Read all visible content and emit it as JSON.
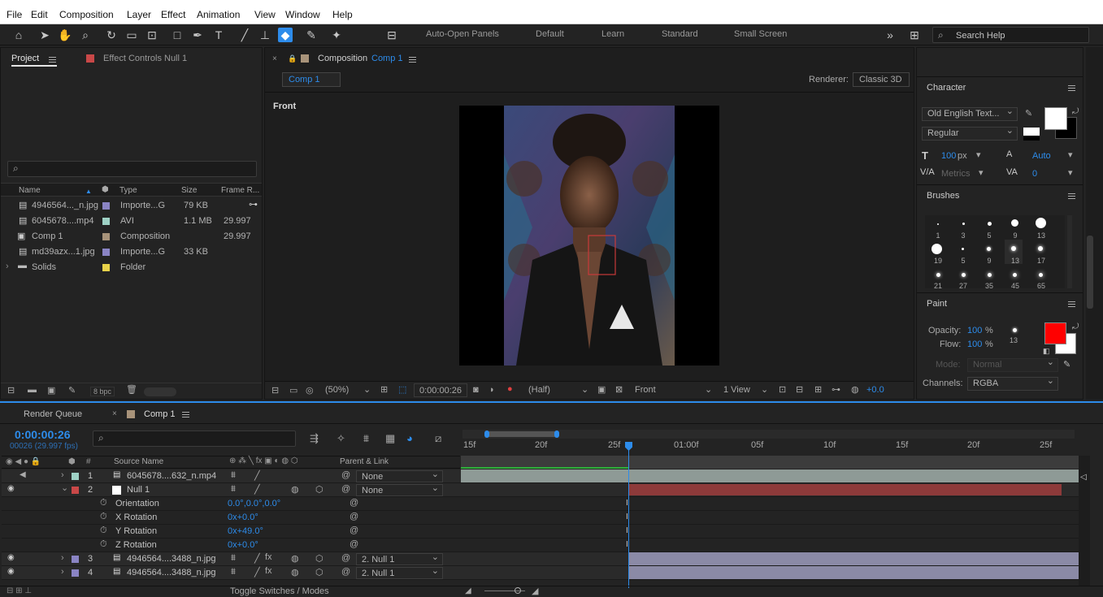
{
  "menu": [
    "File",
    "Edit",
    "Composition",
    "Layer",
    "Effect",
    "Animation",
    "View",
    "Window",
    "Help"
  ],
  "toolbar": {
    "auto_open": "Auto-Open Panels",
    "workspaces": [
      "Default",
      "Learn",
      "Standard",
      "Small Screen"
    ],
    "search_help": "Search Help"
  },
  "project": {
    "tab_project": "Project",
    "tab_effect": "Effect Controls Null 1",
    "columns": [
      "Name",
      "Type",
      "Size",
      "Frame R..."
    ],
    "items": [
      {
        "name": "4946564..._n.jpg",
        "type": "Importe...G",
        "size": "79 KB",
        "fr": "",
        "color": "#8a84c4"
      },
      {
        "name": "6045678....mp4",
        "type": "AVI",
        "size": "1.1 MB",
        "fr": "29.997",
        "color": "#9ed1c5"
      },
      {
        "name": "Comp 1",
        "type": "Composition",
        "size": "",
        "fr": "29.997",
        "color": "#a8937a"
      },
      {
        "name": "md39azx...1.jpg",
        "type": "Importe...G",
        "size": "33 KB",
        "fr": "",
        "color": "#8a84c4"
      },
      {
        "name": "Solids",
        "type": "Folder",
        "size": "",
        "fr": "",
        "color": "#e8d24a"
      }
    ],
    "bpc": "8 bpc"
  },
  "composition": {
    "tab_label": "Composition",
    "tab_comp": "Comp 1",
    "sub_tab": "Comp 1",
    "renderer_label": "Renderer:",
    "renderer_value": "Classic 3D",
    "view_label": "Front",
    "footer": {
      "zoom": "(50%)",
      "time": "0:00:00:26",
      "resolution": "(Half)",
      "camera": "Front",
      "views": "1 View",
      "exposure": "+0.0"
    }
  },
  "character": {
    "title": "Character",
    "font": "Old English Text...",
    "style": "Regular",
    "size": "100",
    "size_unit": "px",
    "leading": "Auto",
    "kerning": "Metrics",
    "tracking": "0",
    "fill_color": "#ffffff",
    "stroke_color": "#000000"
  },
  "brushes": {
    "title": "Brushes",
    "sizes": [
      "1",
      "3",
      "5",
      "9",
      "13",
      "19",
      "5",
      "9",
      "13",
      "17",
      "21",
      "27",
      "35",
      "45",
      "65"
    ]
  },
  "paint": {
    "title": "Paint",
    "opacity_label": "Opacity:",
    "opacity": "100",
    "flow_label": "Flow:",
    "flow": "100",
    "pct": "%",
    "brush_size": "13",
    "mode_label": "Mode:",
    "mode_value": "Normal",
    "channels_label": "Channels:",
    "channels_value": "RGBA",
    "fg_color": "#ff0000",
    "bg_color": "#ffffff"
  },
  "timeline": {
    "render_queue": "Render Queue",
    "comp_tab": "Comp 1",
    "timecode": "0:00:00:26",
    "frame_info": "00026 (29.997 fps)",
    "col_source": "Source Name",
    "col_parent": "Parent & Link",
    "ruler": [
      "15f",
      "20f",
      "25f",
      "01:00f",
      "05f",
      "10f",
      "15f",
      "20f",
      "25f"
    ],
    "layers": [
      {
        "num": "1",
        "name": "6045678....632_n.mp4",
        "parent": "None",
        "color": "#9ed1c5",
        "bar": "#8e9a96"
      },
      {
        "num": "2",
        "name": "Null 1",
        "parent": "None",
        "color": "#c94848",
        "bar": "#8d3a3a"
      },
      {
        "num": "3",
        "name": "4946564....3488_n.jpg",
        "parent": "2. Null 1",
        "color": "#8a84c4",
        "bar": "#8b8aa6"
      },
      {
        "num": "4",
        "name": "4946564....3488_n.jpg",
        "parent": "2. Null 1",
        "color": "#8a84c4",
        "bar": "#8b8aa6"
      }
    ],
    "props": [
      {
        "name": "Orientation",
        "value": "0.0°,0.0°,0.0°"
      },
      {
        "name": "X Rotation",
        "value": "0x+0.0°"
      },
      {
        "name": "Y Rotation",
        "value": "0x+49.0°"
      },
      {
        "name": "Z Rotation",
        "value": "0x+0.0°"
      }
    ],
    "toggle": "Toggle Switches / Modes"
  }
}
